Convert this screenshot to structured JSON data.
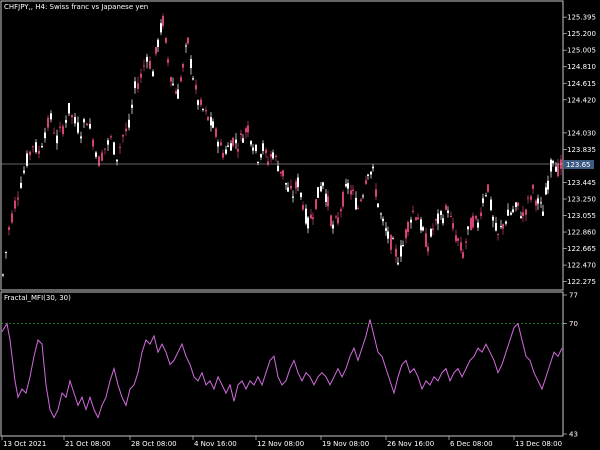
{
  "window": {
    "title": "CHFJPY,, H4:  Swiss franc vs Japanese yen",
    "indicator_title": "Fractal_MFI(30, 30)"
  },
  "colors": {
    "background": "#000000",
    "grid_axis": "#c8c8c8",
    "bull_candle": "#ffffff",
    "bear_candle": "#d4427a",
    "indicator_line": "#d36bdd",
    "level_line": "#1fa01f",
    "price_marker_bg": "#3b5a84"
  },
  "price_axis": {
    "ticks": [
      "125.395",
      "125.200",
      "125.005",
      "124.810",
      "124.615",
      "124.420",
      "124.030",
      "123.835",
      "123.445",
      "123.250",
      "123.055",
      "122.860",
      "122.665",
      "122.470",
      "122.275"
    ],
    "current_price": "123.65"
  },
  "indicator_axis": {
    "ticks": [
      "77",
      "70",
      "43"
    ],
    "level": 70
  },
  "time_axis": {
    "labels": [
      "13 Oct 2021",
      "21 Oct 08:00",
      "28 Oct 08:00",
      "4 Nov 16:00",
      "12 Nov 08:00",
      "19 Nov 08:00",
      "26 Nov 16:00",
      "6 Dec 08:00",
      "13 Dec 08:00"
    ]
  },
  "chart_data": [
    {
      "type": "candlestick",
      "title": "CHFJPY,, H4:  Swiss franc vs Japanese yen",
      "ylim": [
        122.2,
        125.55
      ],
      "close_path": [
        [
          0,
          122.35
        ],
        [
          6,
          122.9
        ],
        [
          12,
          123.2
        ],
        [
          18,
          123.45
        ],
        [
          24,
          123.7
        ],
        [
          30,
          123.9
        ],
        [
          36,
          123.8
        ],
        [
          42,
          124.05
        ],
        [
          48,
          124.2
        ],
        [
          54,
          123.95
        ],
        [
          60,
          124.1
        ],
        [
          66,
          124.3
        ],
        [
          72,
          124.15
        ],
        [
          78,
          124.05
        ],
        [
          84,
          124.2
        ],
        [
          90,
          123.95
        ],
        [
          96,
          123.7
        ],
        [
          102,
          123.85
        ],
        [
          108,
          123.95
        ],
        [
          114,
          123.75
        ],
        [
          120,
          124.0
        ],
        [
          126,
          124.1
        ],
        [
          132,
          124.55
        ],
        [
          138,
          124.7
        ],
        [
          144,
          124.95
        ],
        [
          150,
          124.75
        ],
        [
          155,
          125.1
        ],
        [
          160,
          125.35
        ],
        [
          165,
          124.9
        ],
        [
          170,
          124.6
        ],
        [
          175,
          124.5
        ],
        [
          180,
          124.8
        ],
        [
          185,
          125.1
        ],
        [
          190,
          124.7
        ],
        [
          195,
          124.4
        ],
        [
          200,
          124.3
        ],
        [
          205,
          124.2
        ],
        [
          210,
          124.1
        ],
        [
          215,
          123.95
        ],
        [
          220,
          123.8
        ],
        [
          225,
          123.85
        ],
        [
          230,
          123.95
        ],
        [
          235,
          123.9
        ],
        [
          240,
          124.0
        ],
        [
          245,
          124.1
        ],
        [
          250,
          123.9
        ],
        [
          255,
          123.75
        ],
        [
          260,
          123.85
        ],
        [
          265,
          123.7
        ],
        [
          270,
          123.8
        ],
        [
          275,
          123.65
        ],
        [
          280,
          123.55
        ],
        [
          285,
          123.35
        ],
        [
          290,
          123.3
        ],
        [
          295,
          123.45
        ],
        [
          300,
          123.2
        ],
        [
          305,
          122.95
        ],
        [
          310,
          123.1
        ],
        [
          315,
          123.3
        ],
        [
          320,
          123.45
        ],
        [
          325,
          123.2
        ],
        [
          330,
          122.9
        ],
        [
          335,
          123.0
        ],
        [
          340,
          123.25
        ],
        [
          345,
          123.4
        ],
        [
          350,
          123.3
        ],
        [
          355,
          123.15
        ],
        [
          360,
          123.35
        ],
        [
          365,
          123.6
        ],
        [
          370,
          123.55
        ],
        [
          375,
          123.2
        ],
        [
          380,
          122.95
        ],
        [
          385,
          122.8
        ],
        [
          390,
          122.7
        ],
        [
          395,
          122.55
        ],
        [
          400,
          122.7
        ],
        [
          405,
          122.95
        ],
        [
          410,
          123.1
        ],
        [
          415,
          123.05
        ],
        [
          420,
          122.85
        ],
        [
          425,
          122.7
        ],
        [
          430,
          122.9
        ],
        [
          435,
          123.0
        ],
        [
          440,
          123.05
        ],
        [
          445,
          123.15
        ],
        [
          450,
          122.9
        ],
        [
          455,
          122.75
        ],
        [
          460,
          122.6
        ],
        [
          465,
          122.85
        ],
        [
          470,
          123.0
        ],
        [
          475,
          122.95
        ],
        [
          480,
          123.25
        ],
        [
          485,
          123.4
        ],
        [
          490,
          123.0
        ],
        [
          495,
          122.8
        ],
        [
          500,
          122.95
        ],
        [
          505,
          123.05
        ],
        [
          510,
          123.1
        ],
        [
          515,
          123.15
        ],
        [
          520,
          123.05
        ],
        [
          525,
          123.2
        ],
        [
          530,
          123.35
        ],
        [
          535,
          123.2
        ],
        [
          540,
          123.1
        ],
        [
          545,
          123.45
        ],
        [
          550,
          123.75
        ],
        [
          555,
          123.6
        ],
        [
          560,
          123.65
        ]
      ]
    },
    {
      "type": "line",
      "title": "Fractal_MFI(30, 30)",
      "ylim": [
        43,
        77
      ],
      "level": 70,
      "points": [
        [
          0,
          68
        ],
        [
          5,
          70
        ],
        [
          8,
          66
        ],
        [
          10,
          62
        ],
        [
          13,
          56
        ],
        [
          16,
          52
        ],
        [
          20,
          54
        ],
        [
          24,
          53
        ],
        [
          28,
          57
        ],
        [
          32,
          62
        ],
        [
          36,
          66
        ],
        [
          40,
          65
        ],
        [
          44,
          55
        ],
        [
          48,
          49
        ],
        [
          52,
          47
        ],
        [
          56,
          49
        ],
        [
          60,
          53
        ],
        [
          64,
          52
        ],
        [
          68,
          56
        ],
        [
          72,
          53
        ],
        [
          76,
          50
        ],
        [
          80,
          52
        ],
        [
          84,
          49
        ],
        [
          88,
          52
        ],
        [
          92,
          49
        ],
        [
          96,
          47
        ],
        [
          100,
          50
        ],
        [
          104,
          52
        ],
        [
          108,
          56
        ],
        [
          112,
          59
        ],
        [
          116,
          55
        ],
        [
          120,
          52
        ],
        [
          124,
          50
        ],
        [
          128,
          54
        ],
        [
          132,
          55
        ],
        [
          136,
          58
        ],
        [
          140,
          63
        ],
        [
          144,
          66
        ],
        [
          148,
          65
        ],
        [
          152,
          67
        ],
        [
          156,
          63
        ],
        [
          160,
          65
        ],
        [
          164,
          63
        ],
        [
          168,
          60
        ],
        [
          172,
          61
        ],
        [
          176,
          63
        ],
        [
          180,
          65
        ],
        [
          184,
          62
        ],
        [
          188,
          60
        ],
        [
          192,
          57
        ],
        [
          196,
          56
        ],
        [
          200,
          58
        ],
        [
          204,
          55
        ],
        [
          208,
          56
        ],
        [
          212,
          54
        ],
        [
          216,
          57
        ],
        [
          220,
          55
        ],
        [
          224,
          53
        ],
        [
          228,
          55
        ],
        [
          232,
          51
        ],
        [
          236,
          55
        ],
        [
          240,
          56
        ],
        [
          244,
          54
        ],
        [
          248,
          56
        ],
        [
          252,
          55
        ],
        [
          256,
          57
        ],
        [
          260,
          55
        ],
        [
          264,
          58
        ],
        [
          268,
          61
        ],
        [
          272,
          62
        ],
        [
          276,
          57
        ],
        [
          280,
          55
        ],
        [
          284,
          56
        ],
        [
          288,
          59
        ],
        [
          292,
          61
        ],
        [
          296,
          58
        ],
        [
          300,
          56
        ],
        [
          304,
          58
        ],
        [
          308,
          57
        ],
        [
          312,
          55
        ],
        [
          316,
          57
        ],
        [
          320,
          58
        ],
        [
          324,
          57
        ],
        [
          328,
          55
        ],
        [
          332,
          57
        ],
        [
          336,
          59
        ],
        [
          340,
          57
        ],
        [
          344,
          59
        ],
        [
          348,
          62
        ],
        [
          352,
          64
        ],
        [
          356,
          61
        ],
        [
          360,
          64
        ],
        [
          364,
          67
        ],
        [
          368,
          71
        ],
        [
          372,
          67
        ],
        [
          376,
          63
        ],
        [
          380,
          62
        ],
        [
          384,
          59
        ],
        [
          388,
          56
        ],
        [
          392,
          53
        ],
        [
          396,
          57
        ],
        [
          400,
          60
        ],
        [
          404,
          61
        ],
        [
          408,
          58
        ],
        [
          412,
          59
        ],
        [
          416,
          57
        ],
        [
          420,
          54
        ],
        [
          424,
          56
        ],
        [
          428,
          55
        ],
        [
          432,
          57
        ],
        [
          436,
          56
        ],
        [
          440,
          58
        ],
        [
          444,
          59
        ],
        [
          448,
          56
        ],
        [
          452,
          58
        ],
        [
          456,
          59
        ],
        [
          460,
          57
        ],
        [
          464,
          59
        ],
        [
          468,
          61
        ],
        [
          472,
          62
        ],
        [
          476,
          64
        ],
        [
          480,
          63
        ],
        [
          484,
          65
        ],
        [
          488,
          63
        ],
        [
          492,
          61
        ],
        [
          496,
          58
        ],
        [
          500,
          60
        ],
        [
          504,
          63
        ],
        [
          508,
          66
        ],
        [
          512,
          69
        ],
        [
          516,
          70
        ],
        [
          520,
          66
        ],
        [
          524,
          62
        ],
        [
          528,
          61
        ],
        [
          532,
          58
        ],
        [
          536,
          56
        ],
        [
          540,
          54
        ],
        [
          544,
          57
        ],
        [
          548,
          60
        ],
        [
          552,
          63
        ],
        [
          556,
          62
        ],
        [
          560,
          64
        ]
      ]
    }
  ]
}
